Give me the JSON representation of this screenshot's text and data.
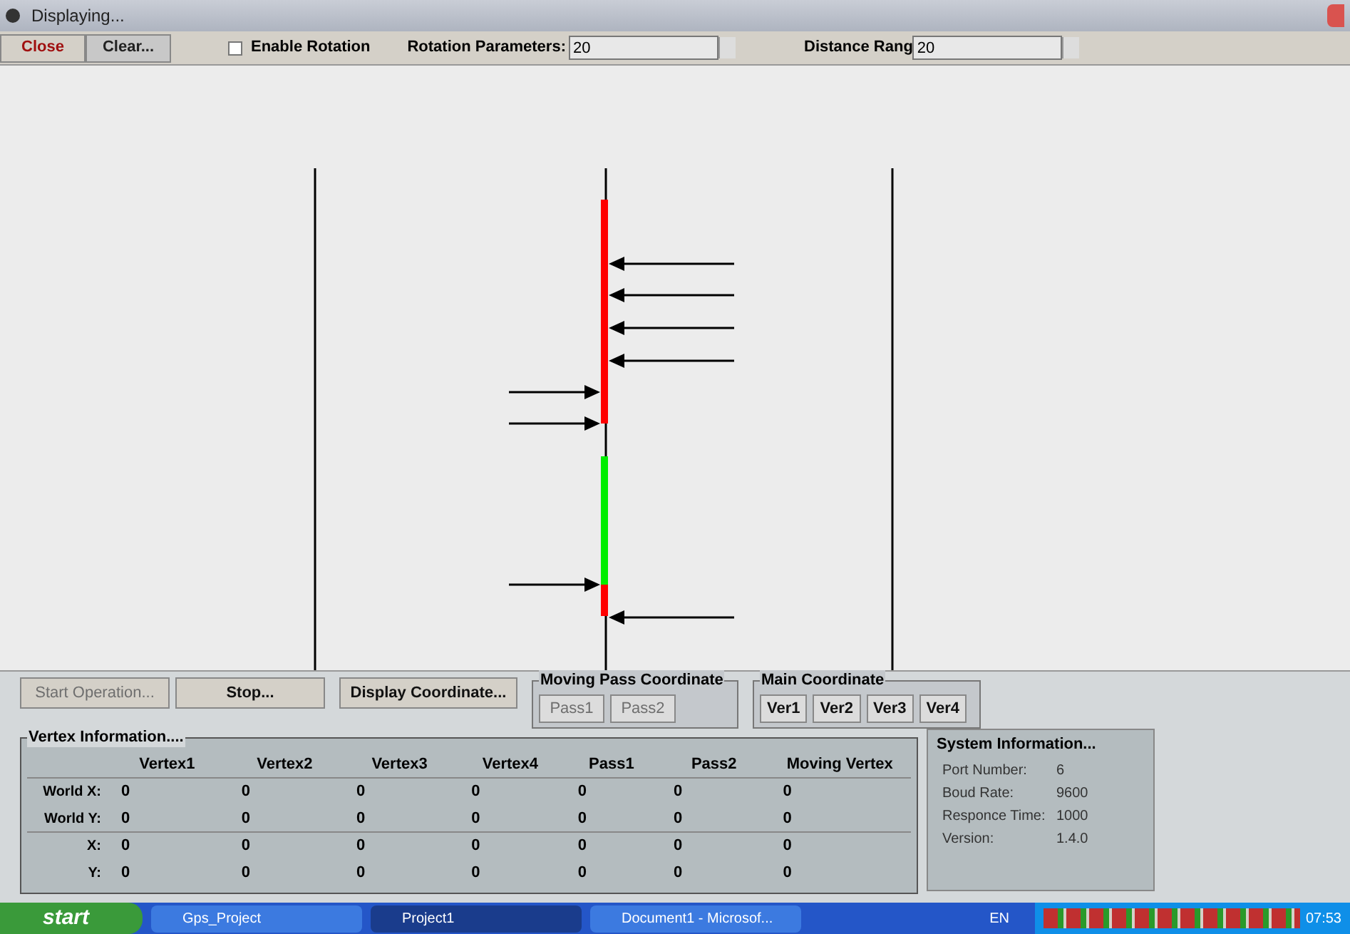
{
  "window": {
    "title": "Displaying..."
  },
  "toolbar": {
    "close": "Close",
    "clear": "Clear...",
    "enable_rotation": {
      "label": "Enable Rotation",
      "checked": false
    },
    "rotation_parameters": {
      "label": "Rotation Parameters:",
      "value": "20"
    },
    "distance_range": {
      "label": "Distance Rang",
      "value": "20"
    }
  },
  "controls": [
    {
      "label": "Start Operation...",
      "disabled": true
    },
    {
      "label": "Stop...",
      "disabled": false
    },
    {
      "label": "Display Coordinate...",
      "disabled": false
    }
  ],
  "moving_pass_coordinate": {
    "title": "Moving Pass Coordinate",
    "buttons": [
      {
        "label": "Pass1",
        "disabled": true
      },
      {
        "label": "Pass2",
        "disabled": true
      }
    ]
  },
  "main_coordinate": {
    "title": "Main Coordinate",
    "buttons": [
      {
        "label": "Ver1",
        "disabled": false
      },
      {
        "label": "Ver2",
        "disabled": false
      },
      {
        "label": "Ver3",
        "disabled": false
      },
      {
        "label": "Ver4",
        "disabled": false
      }
    ]
  },
  "vertex_information": {
    "title": "Vertex Information....",
    "columns": [
      "Vertex1",
      "Vertex2",
      "Vertex3",
      "Vertex4",
      "Pass1",
      "Pass2",
      "Moving Vertex"
    ],
    "rows": [
      {
        "label": "World X:",
        "cells": [
          "0",
          "0",
          "0",
          "0",
          "0",
          "0",
          "0"
        ]
      },
      {
        "label": "World Y:",
        "cells": [
          "0",
          "0",
          "0",
          "0",
          "0",
          "0",
          "0"
        ]
      },
      {
        "label": "X:",
        "cells": [
          "0",
          "0",
          "0",
          "0",
          "0",
          "0",
          "0"
        ]
      },
      {
        "label": "Y:",
        "cells": [
          "0",
          "0",
          "0",
          "0",
          "0",
          "0",
          "0"
        ]
      }
    ]
  },
  "system_information": {
    "title": "System Information...",
    "fields": [
      {
        "label": "Port Number:",
        "value": "6"
      },
      {
        "label": "Boud Rate:",
        "value": "9600"
      },
      {
        "label": "Responce Time:",
        "value": "1000"
      },
      {
        "label": "Version:",
        "value": "1.4.0"
      }
    ]
  },
  "taskbar": {
    "start": "start",
    "tasks": [
      {
        "label": "Gps_Project",
        "selected": false
      },
      {
        "label": "Project1",
        "selected": true
      },
      {
        "label": "Document1 - Microsof...",
        "selected": false
      }
    ],
    "language": "EN",
    "clock": "07:53"
  }
}
